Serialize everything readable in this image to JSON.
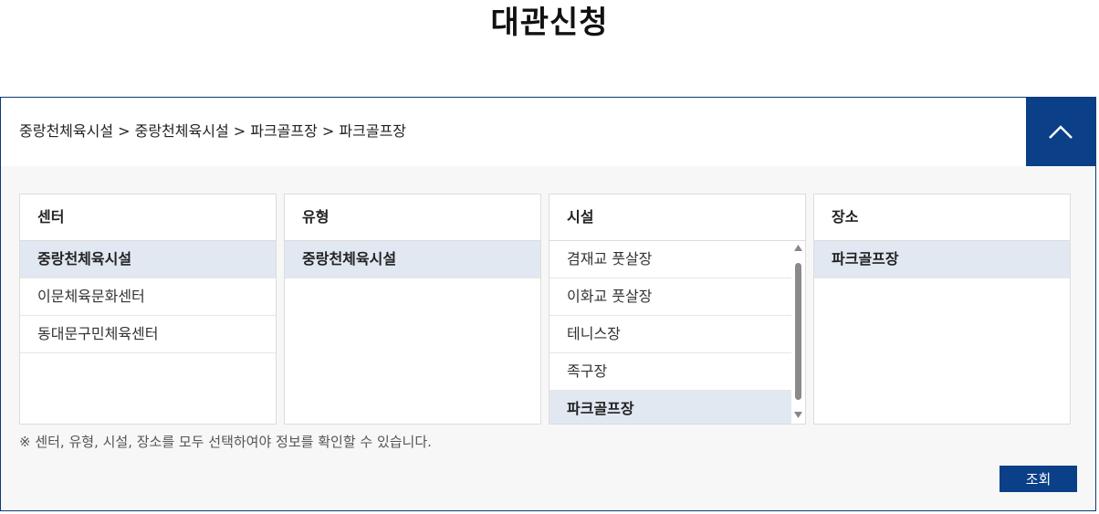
{
  "page": {
    "title": "대관신청"
  },
  "breadcrumb": {
    "text": "중랑천체육시설 > 중랑천체육시설 > 파크골프장 > 파크골프장"
  },
  "columns": [
    {
      "header": "센터",
      "items": [
        "중랑천체육시설",
        "이문체육문화센터",
        "동대문구민체육센터"
      ],
      "selected": 0
    },
    {
      "header": "유형",
      "items": [
        "중랑천체육시설"
      ],
      "selected": 0
    },
    {
      "header": "시설",
      "items": [
        "겸재교 풋살장",
        "이화교 풋살장",
        "테니스장",
        "족구장",
        "파크골프장"
      ],
      "selected": 4
    },
    {
      "header": "장소",
      "items": [
        "파크골프장"
      ],
      "selected": 0
    }
  ],
  "notice": "※ 센터, 유형, 시설, 장소를 모두 선택하여야 정보를 확인할 수 있습니다.",
  "search_button": "조회",
  "icons": {
    "collapse": "chevron-up-icon",
    "scroll_up": "triangle-up-icon",
    "scroll_down": "triangle-down-icon"
  },
  "colors": {
    "accent": "#0b3f87",
    "selected": "#e1e8f2"
  }
}
